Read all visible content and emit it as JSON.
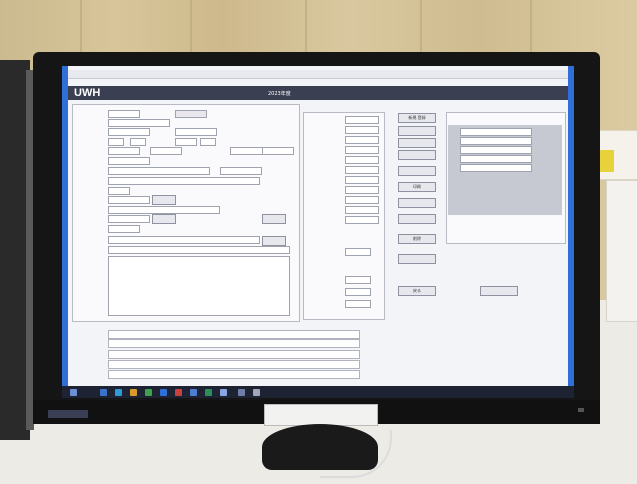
{
  "screen": {
    "logo": "UWH",
    "header_year": "2023年度",
    "window_title": "",
    "brand_label": "",
    "colors": {
      "header": "#3a3f52",
      "window_border": "#2f6fd8",
      "taskbar": "#1d2333"
    }
  },
  "buttons": [
    {
      "label": "新規 登録"
    },
    {
      "label": "印刷"
    },
    {
      "label": "削除"
    },
    {
      "label": "戻る"
    }
  ]
}
